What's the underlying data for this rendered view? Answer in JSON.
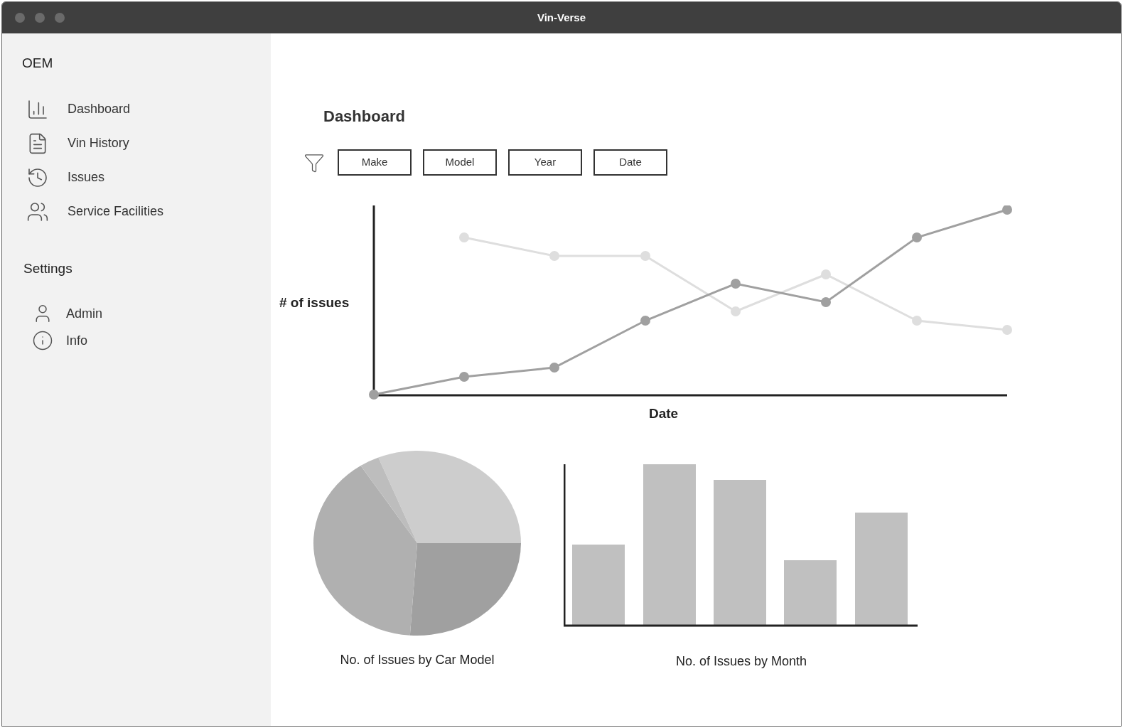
{
  "window": {
    "title": "Vin-Verse"
  },
  "sidebar": {
    "heading": "OEM",
    "items": [
      {
        "label": "Dashboard"
      },
      {
        "label": "Vin History"
      },
      {
        "label": "Issues"
      },
      {
        "label": "Service Facilities"
      }
    ],
    "settings_heading": "Settings",
    "settings_items": [
      {
        "label": "Admin"
      },
      {
        "label": "Info"
      }
    ]
  },
  "main": {
    "title": "Dashboard",
    "filters": [
      "Make",
      "Model",
      "Year",
      "Date"
    ],
    "line_chart": {
      "ylabel": "# of issues",
      "xlabel": "Date"
    },
    "pie_chart": {
      "caption": "No. of Issues by Car Model"
    },
    "bar_chart": {
      "caption": "No. of Issues by Month"
    }
  }
}
